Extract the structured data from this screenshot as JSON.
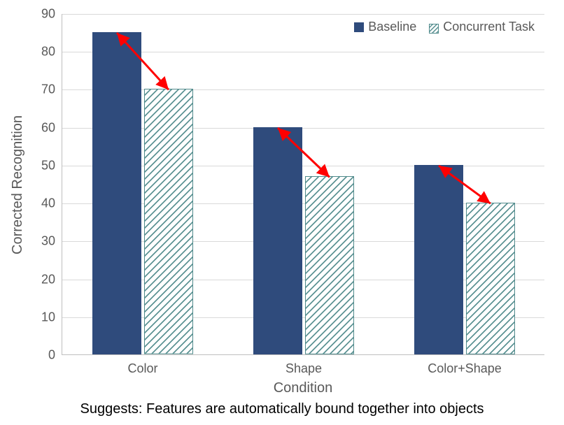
{
  "chart_data": {
    "type": "bar",
    "categories": [
      "Color",
      "Shape",
      "Color+Shape"
    ],
    "series": [
      {
        "name": "Baseline",
        "values": [
          85,
          60,
          50
        ]
      },
      {
        "name": "Concurrent Task",
        "values": [
          70,
          47,
          40
        ]
      }
    ],
    "xlabel": "Condition",
    "ylabel": "Corrected Recognition",
    "ylim": [
      0,
      90
    ],
    "y_ticks": [
      0,
      10,
      20,
      30,
      40,
      50,
      60,
      70,
      80,
      90
    ],
    "legend_position": "top-right",
    "annotations": [
      "double-headed red arrow between paired bars"
    ],
    "title": ""
  },
  "colors": {
    "baseline_fill": "#2f4b7c",
    "concurrent_stroke": "#4f8a8b",
    "arrow": "#ff0000",
    "grid": "#d9d9d9",
    "text": "#595959"
  },
  "caption": "Suggests: Features are automatically bound together into objects"
}
